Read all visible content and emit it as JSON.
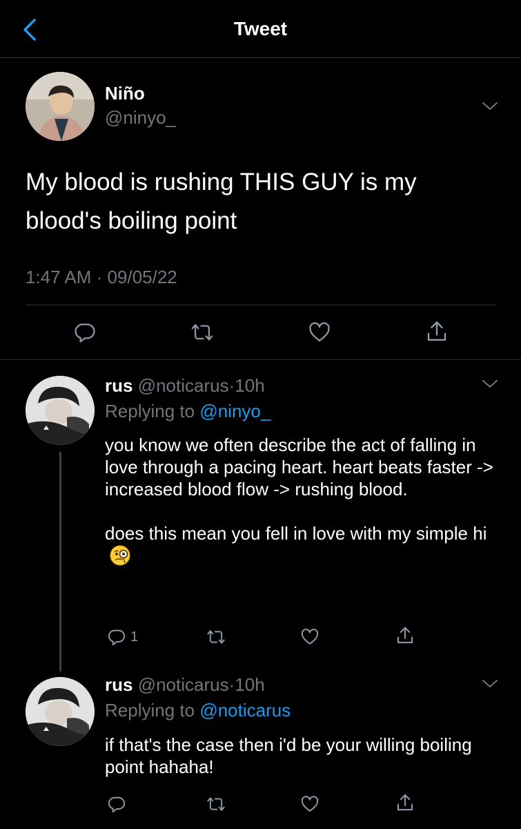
{
  "header": {
    "title": "Tweet"
  },
  "tweet": {
    "name": "Niño",
    "handle": "@ninyo_",
    "text": "My blood is rushing THIS GUY is my blood's boiling point",
    "time": "1:47 AM",
    "separator": "·",
    "date": "09/05/22"
  },
  "replies": [
    {
      "name": "rus",
      "handle": "@noticarus",
      "separator": "·",
      "time": "10h",
      "replying_label": "Replying to",
      "replying_to": "@ninyo_",
      "text": "you know we often describe the act of falling in love through a pacing heart. heart beats faster -> increased blood flow -> rushing blood.\n\ndoes this mean you fell in love with my simple hi",
      "emoji": "face-with-monocle",
      "reply_count": "1"
    },
    {
      "name": "rus",
      "handle": "@noticarus",
      "separator": "·",
      "time": "10h",
      "replying_label": "Replying to",
      "replying_to": "@noticarus",
      "text": "if that's the case then i'd be your willing boiling point hahaha!"
    }
  ],
  "colors": {
    "background": "#000000",
    "accent": "#1d9bf0",
    "secondary_text": "#71767b",
    "divider": "#2f3336"
  },
  "icons": [
    "back-chevron-icon",
    "chevron-down-icon",
    "reply-icon",
    "retweet-icon",
    "like-icon",
    "share-icon"
  ]
}
